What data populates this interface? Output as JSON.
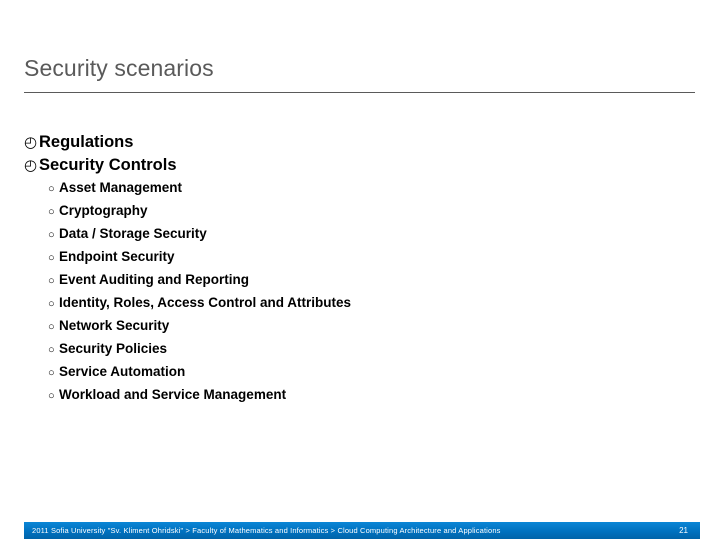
{
  "slide": {
    "title": "Security scenarios",
    "page_number": "21",
    "accent_color": "#0077c8",
    "title_color": "#5a5a5a",
    "body_color": "#000000"
  },
  "bullets": {
    "level1_glyph": "◴",
    "level1_glyph_name": "clock-bullet-icon",
    "level2_glyph": "○",
    "level2_glyph_name": "hollow-circle-bullet-icon"
  },
  "outline": {
    "items": [
      {
        "label": "Regulations"
      },
      {
        "label": "Security Controls"
      }
    ],
    "sub_items": [
      {
        "label": "Asset Management"
      },
      {
        "label": "Cryptography"
      },
      {
        "label": "Data / Storage Security"
      },
      {
        "label": "Endpoint Security"
      },
      {
        "label": "Event Auditing and Reporting"
      },
      {
        "label": "Identity, Roles, Access Control and Attributes"
      },
      {
        "label": "Network Security"
      },
      {
        "label": "Security Policies"
      },
      {
        "label": "Service Automation"
      },
      {
        "label": "Workload and Service Management"
      }
    ]
  },
  "footer": {
    "text": "2011 Sofia University \"Sv. Kliment Ohridski\" > Faculty of Mathematics and Informatics > Cloud Computing Architecture and Applications"
  }
}
